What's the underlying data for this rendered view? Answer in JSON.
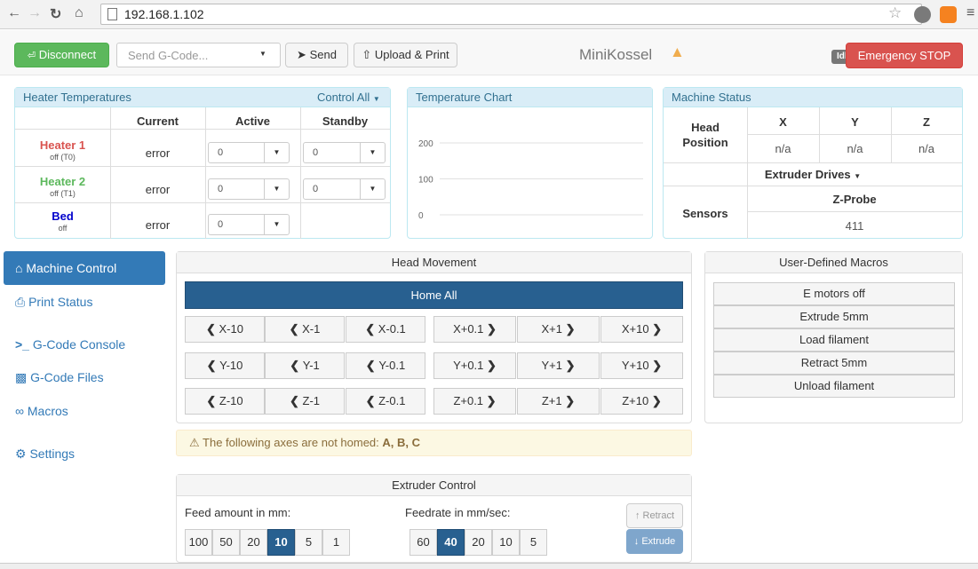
{
  "browser": {
    "url": "192.168.1.102"
  },
  "navbar": {
    "disconnect_label": "Disconnect",
    "gcode_placeholder": "Send G-Code...",
    "send_label": "Send",
    "upload_label": "Upload & Print",
    "machine_name": "MiniKossel",
    "status_badge": "Idle",
    "emergency_label": "Emergency STOP"
  },
  "heater_panel": {
    "title": "Heater Temperatures",
    "control_all": "Control All",
    "col_current": "Current",
    "col_active": "Active",
    "col_standby": "Standby",
    "rows": [
      {
        "name": "Heater 1",
        "sub": "off (T0)",
        "current": "error",
        "active": "0",
        "standby": "0",
        "color": "#d9534f"
      },
      {
        "name": "Heater 2",
        "sub": "off (T1)",
        "current": "error",
        "active": "0",
        "standby": "0",
        "color": "#5cb85c"
      },
      {
        "name": "Bed",
        "sub": "off",
        "current": "error",
        "active": "0",
        "standby": "",
        "color": "#0000cc"
      }
    ]
  },
  "temp_chart": {
    "title": "Temperature Chart",
    "chart_data": {
      "type": "line",
      "yticks": [
        "200",
        "100",
        "0"
      ],
      "ylim": [
        0,
        250
      ],
      "series": []
    }
  },
  "machine_status": {
    "title": "Machine Status",
    "head_label": "Head",
    "position_label": "Position",
    "x_label": "X",
    "y_label": "Y",
    "z_label": "Z",
    "x_val": "n/a",
    "y_val": "n/a",
    "z_val": "n/a",
    "extruder_drives": "Extruder Drives",
    "sensors_label": "Sensors",
    "zprobe_label": "Z-Probe",
    "zprobe_val": "411"
  },
  "sidebar": {
    "items": [
      {
        "label": "Machine Control"
      },
      {
        "label": "Print Status"
      },
      {
        "label": "G-Code Console"
      },
      {
        "label": "G-Code Files"
      },
      {
        "label": "Macros"
      },
      {
        "label": "Settings"
      }
    ]
  },
  "head_movement": {
    "title": "Head Movement",
    "home_all": "Home All",
    "rows": [
      [
        "X-10",
        "X-1",
        "X-0.1",
        "X+0.1",
        "X+1",
        "X+10"
      ],
      [
        "Y-10",
        "Y-1",
        "Y-0.1",
        "Y+0.1",
        "Y+1",
        "Y+10"
      ],
      [
        "Z-10",
        "Z-1",
        "Z-0.1",
        "Z+0.1",
        "Z+1",
        "Z+10"
      ]
    ]
  },
  "warning": {
    "text": "The following axes are not homed:",
    "axes": "A, B, C"
  },
  "macros": {
    "title": "User-Defined Macros",
    "items": [
      "E motors off",
      "Extrude 5mm",
      "Load filament",
      "Retract 5mm",
      "Unload filament"
    ]
  },
  "extruder": {
    "title": "Extruder Control",
    "feed_label": "Feed amount in mm:",
    "feed_values": [
      "100",
      "50",
      "20",
      "10",
      "5",
      "1"
    ],
    "feed_selected": "10",
    "rate_label": "Feedrate in mm/sec:",
    "rate_values": [
      "60",
      "40",
      "20",
      "10",
      "5"
    ],
    "rate_selected": "40",
    "retract_label": "Retract",
    "extrude_label": "Extrude"
  }
}
